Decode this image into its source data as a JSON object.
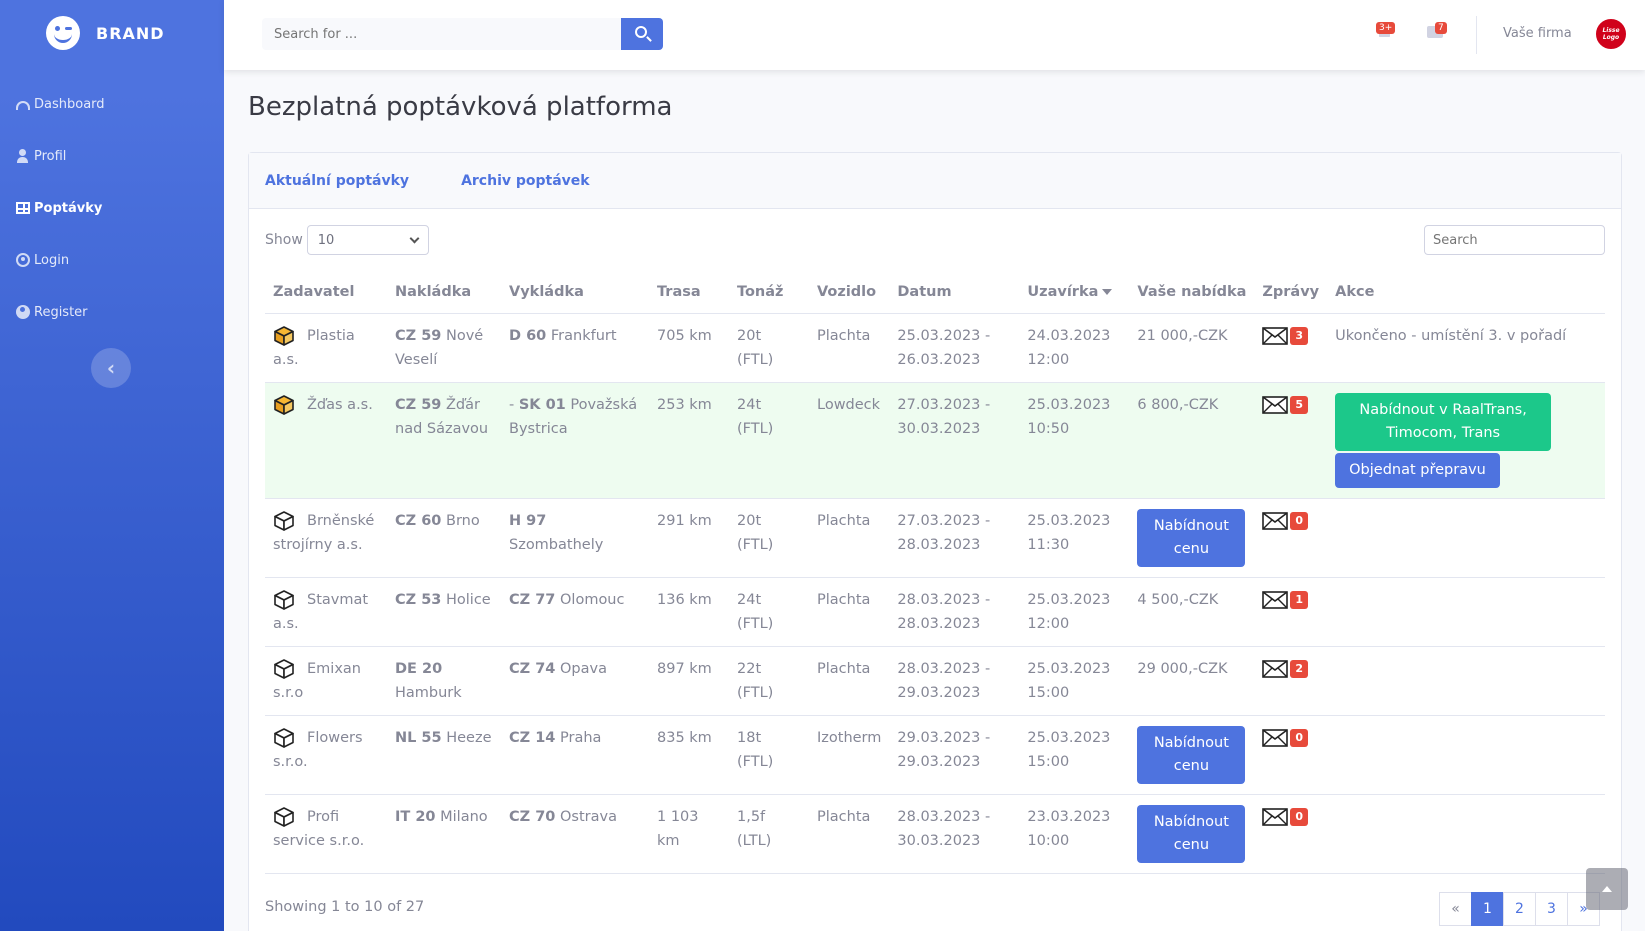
{
  "brand": "BRAND",
  "sidebar": {
    "items": [
      {
        "label": "Dashboard",
        "icon": "gauge-icon"
      },
      {
        "label": "Profil",
        "icon": "user-icon"
      },
      {
        "label": "Poptávky",
        "icon": "table-icon",
        "active": true
      },
      {
        "label": "Login",
        "icon": "user-circle-icon"
      },
      {
        "label": "Register",
        "icon": "user-circle-filled-icon"
      }
    ]
  },
  "topbar": {
    "search_placeholder": "Search for ...",
    "alerts_badge": "3+",
    "messages_badge": "7",
    "company": "Vaše firma",
    "avatar_text": "Lisse Logo"
  },
  "page_title": "Bezplatná poptávková platforma",
  "tabs": [
    "Aktuální poptávky",
    "Archiv poptávek"
  ],
  "controls": {
    "show_label": "Show",
    "show_value": "10",
    "search_placeholder": "Search"
  },
  "columns": [
    "Zadavatel",
    "Nakládka",
    "Vykládka",
    "Trasa",
    "Tonáž",
    "Vozidlo",
    "Datum",
    "Uzavírka",
    "Vaše nabídka",
    "Zprávy",
    "Akce"
  ],
  "rows": [
    {
      "client": "Plastia a.s.",
      "icon": "gold",
      "load_code": "CZ 59",
      "load_city": "Nové Veselí",
      "unload_prefix": "",
      "unload_code": "D 60",
      "unload_city": "Frankfurt",
      "route": "705 km",
      "tonnage": "20t (FTL)",
      "vehicle": "Plachta",
      "date1": "25.03.2023 -",
      "date2": "26.03.2023",
      "close1": "24.03.2023",
      "close2": "12:00",
      "offer": "21 000,-CZK",
      "messages": "3",
      "action_text": "Ukončeno - umístění  3. v pořadí"
    },
    {
      "client": "Žďas a.s.",
      "icon": "gold",
      "highlight": true,
      "load_code": "CZ 59",
      "load_city": "Žďár nad Sázavou",
      "unload_prefix": "- ",
      "unload_code": "SK 01",
      "unload_city": "Považská Bystrica",
      "route": "253 km",
      "tonnage": "24t (FTL)",
      "vehicle": "Lowdeck",
      "date1": "27.03.2023 -",
      "date2": "30.03.2023",
      "close1": "25.03.2023",
      "close2": "10:50",
      "offer": "6 800,-CZK",
      "messages": "5",
      "action_green": "Nabídnout v  RaalTrans, Timocom, Trans",
      "action_order": "Objednat přepravu"
    },
    {
      "client": "Brněnské strojírny a.s.",
      "icon": "dark",
      "load_code": "CZ 60",
      "load_city": "Brno",
      "unload_prefix": "",
      "unload_code": "H 97",
      "unload_city": "Szombathely",
      "route": "291 km",
      "tonnage": "20t (FTL)",
      "vehicle": "Plachta",
      "date1": "27.03.2023 -",
      "date2": "28.03.2023",
      "close1": "25.03.2023",
      "close2": "11:30",
      "offer_button": "Nabídnout cenu",
      "messages": "0"
    },
    {
      "client": "Stavmat a.s.",
      "icon": "dark",
      "load_code": "CZ 53",
      "load_city": "Holice",
      "unload_prefix": "",
      "unload_code": "CZ 77",
      "unload_city": "Olomouc",
      "route": "136 km",
      "tonnage": "24t (FTL)",
      "vehicle": "Plachta",
      "date1": "28.03.2023 -",
      "date2": "28.03.2023",
      "close1": "25.03.2023",
      "close2": "12:00",
      "offer": "4 500,-CZK",
      "messages": "1"
    },
    {
      "client": "Emixan s.r.o",
      "icon": "dark",
      "load_code": "DE 20",
      "load_city": "Hamburk",
      "unload_prefix": "",
      "unload_code": "CZ 74",
      "unload_city": "Opava",
      "route": "897 km",
      "tonnage": "22t (FTL)",
      "vehicle": "Plachta",
      "date1": "28.03.2023 -",
      "date2": "29.03.2023",
      "close1": "25.03.2023",
      "close2": "15:00",
      "offer": "29 000,-CZK",
      "messages": "2"
    },
    {
      "client": "Flowers s.r.o.",
      "icon": "dark",
      "load_code": "NL 55",
      "load_city": "Heeze",
      "unload_prefix": "",
      "unload_code": "CZ 14",
      "unload_city": "Praha",
      "route": "835 km",
      "tonnage": "18t (FTL)",
      "vehicle": "Izotherm",
      "date1": "29.03.2023 -",
      "date2": "29.03.2023",
      "close1": "25.03.2023",
      "close2": "15:00",
      "offer_button": "Nabídnout cenu",
      "messages": "0"
    },
    {
      "client": "Profi service s.r.o.",
      "icon": "dark",
      "load_code": "IT 20",
      "load_city": "Milano",
      "unload_prefix": "",
      "unload_code": "CZ 70",
      "unload_city": "Ostrava",
      "route": "1 103 km",
      "tonnage": "1,5f (LTL)",
      "vehicle": "Plachta",
      "date1": "28.03.2023 -",
      "date2": "30.03.2023",
      "close1": "23.03.2023",
      "close2": "10:00",
      "offer_button": "Nabídnout cenu",
      "messages": "0"
    }
  ],
  "footer": {
    "info": "Showing 1 to 10 of 27",
    "pages": [
      "«",
      "1",
      "2",
      "3",
      "»"
    ],
    "active_page": "1"
  }
}
